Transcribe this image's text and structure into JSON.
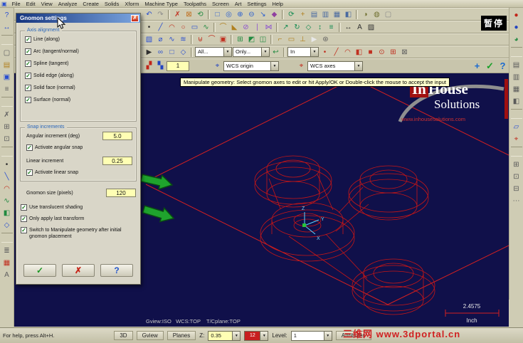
{
  "app": {
    "pause_overlay": "暂停"
  },
  "menu": {
    "app_icon_glyph": "▣",
    "items": [
      "File",
      "Edit",
      "View",
      "Analyze",
      "Create",
      "Solids",
      "Xform",
      "Machine Type",
      "Toolpaths",
      "Screen",
      "Art",
      "Settings",
      "Help"
    ]
  },
  "toolbars": {
    "row1": [
      {
        "n": "undo-icon",
        "g": "↶",
        "c": "#2a4fd0"
      },
      {
        "n": "redo-icon",
        "g": "↷",
        "c": "#8a8a8a"
      },
      {
        "n": "separator"
      },
      {
        "n": "delete-entities-icon",
        "g": "✗",
        "c": "#c03020"
      },
      {
        "n": "delete-duplicates-icon",
        "g": "⊠",
        "c": "#c07020"
      },
      {
        "n": "undelete-icon",
        "g": "⟲",
        "c": "#208a40"
      },
      {
        "n": "separator"
      },
      {
        "n": "zoom-window-icon",
        "g": "□",
        "c": "#2a5fd0"
      },
      {
        "n": "zoom-target-icon",
        "g": "◎",
        "c": "#2a5fd0"
      },
      {
        "n": "zoom-in-icon",
        "g": "⊕",
        "c": "#2a5fd0"
      },
      {
        "n": "zoom-out-icon",
        "g": "⊖",
        "c": "#2a5fd0"
      },
      {
        "n": "unzoom-icon",
        "g": "↘",
        "c": "#2a5fd0"
      },
      {
        "n": "repaint-icon",
        "g": "◆",
        "c": "#9040a0"
      },
      {
        "n": "separator"
      },
      {
        "n": "dynamic-rotate-icon",
        "g": "⟳",
        "c": "#108a50"
      },
      {
        "n": "pan-icon",
        "g": "+",
        "c": "#b08020"
      },
      {
        "n": "gview-top-icon",
        "g": "▤",
        "c": "#4a6aa0"
      },
      {
        "n": "gview-front-icon",
        "g": "▥",
        "c": "#4a6aa0"
      },
      {
        "n": "gview-right-icon",
        "g": "▦",
        "c": "#4a6aa0"
      },
      {
        "n": "gview-iso-icon",
        "g": "◧",
        "c": "#4a6aa0"
      },
      {
        "n": "separator"
      },
      {
        "n": "shading-icon",
        "g": "◑",
        "c": "#707030"
      },
      {
        "n": "wireframe-icon",
        "g": "◍",
        "c": "#707030"
      },
      {
        "n": "screen-blank-icon",
        "g": "▢",
        "c": "#8a8a8a"
      }
    ],
    "row2": [
      {
        "n": "create-point-icon",
        "g": "•",
        "c": "#303030"
      },
      {
        "n": "create-line-icon",
        "g": "╱",
        "c": "#2a4fd0"
      },
      {
        "n": "create-arc-icon",
        "g": "◠",
        "c": "#c03020"
      },
      {
        "n": "create-circle-icon",
        "g": "○",
        "c": "#c03020"
      },
      {
        "n": "create-rectangle-icon",
        "g": "▭",
        "c": "#2a4fd0"
      },
      {
        "n": "create-spline-icon",
        "g": "∿",
        "c": "#208a40"
      },
      {
        "n": "separator"
      },
      {
        "n": "fillet-icon",
        "g": "⌒",
        "c": "#b08020"
      },
      {
        "n": "chamfer-icon",
        "g": "◣",
        "c": "#b08020"
      },
      {
        "n": "trim-icon",
        "g": "⊘",
        "c": "#8a4fd0"
      },
      {
        "n": "break-icon",
        "g": "∣",
        "c": "#8a4fd0"
      },
      {
        "n": "join-icon",
        "g": "⋈",
        "c": "#8a4fd0"
      },
      {
        "n": "separator"
      },
      {
        "n": "xform-translate-icon",
        "g": "↗",
        "c": "#108a50"
      },
      {
        "n": "xform-rotate-icon",
        "g": "↻",
        "c": "#108a50"
      },
      {
        "n": "xform-mirror-icon",
        "g": "◇",
        "c": "#108a50"
      },
      {
        "n": "xform-scale-icon",
        "g": "↕",
        "c": "#108a50"
      },
      {
        "n": "xform-offset-icon",
        "g": "≡",
        "c": "#108a50"
      },
      {
        "n": "separator"
      },
      {
        "n": "dimension-icon",
        "g": "↔",
        "c": "#303030"
      },
      {
        "n": "note-text-icon",
        "g": "A",
        "c": "#303030"
      },
      {
        "n": "hatch-icon",
        "g": "▨",
        "c": "#303030"
      }
    ],
    "row3": [
      {
        "n": "solid-extrude-icon",
        "g": "▧",
        "c": "#2a4fd0"
      },
      {
        "n": "solid-revolve-icon",
        "g": "⌀",
        "c": "#2a4fd0"
      },
      {
        "n": "solid-sweep-icon",
        "g": "∿",
        "c": "#2a4fd0"
      },
      {
        "n": "solid-loft-icon",
        "g": "≋",
        "c": "#2a4fd0"
      },
      {
        "n": "separator"
      },
      {
        "n": "solid-boolean-icon",
        "g": "⊎",
        "c": "#c03020"
      },
      {
        "n": "solid-fillet-icon",
        "g": "⌒",
        "c": "#c03020"
      },
      {
        "n": "solid-shell-icon",
        "g": "▣",
        "c": "#c03020"
      },
      {
        "n": "separator"
      },
      {
        "n": "surface-net-icon",
        "g": "⊞",
        "c": "#208a40"
      },
      {
        "n": "surface-trim-icon",
        "g": "◩",
        "c": "#208a40"
      },
      {
        "n": "surface-blend-icon",
        "g": "◫",
        "c": "#208a40"
      },
      {
        "n": "separator"
      },
      {
        "n": "toolpath-contour-icon",
        "g": "⌐",
        "c": "#b08020"
      },
      {
        "n": "toolpath-pocket-icon",
        "g": "▭",
        "c": "#b08020"
      },
      {
        "n": "toolpath-drill-icon",
        "g": "⊥",
        "c": "#b08020"
      },
      {
        "n": "select-arrow-icon",
        "g": "▶",
        "c": "#e8e8e8"
      },
      {
        "n": "machine-settings-icon",
        "g": "⊛",
        "c": "#606060"
      }
    ],
    "row4_pre": [
      {
        "n": "selection-cursor-icon",
        "g": "▶",
        "c": "#303030"
      },
      {
        "n": "chain-select-icon",
        "g": "∞",
        "c": "#2a4fd0"
      },
      {
        "n": "window-select-icon",
        "g": "□",
        "c": "#2a4fd0"
      },
      {
        "n": "polygon-select-icon",
        "g": "◇",
        "c": "#2a4fd0"
      },
      {
        "n": "separator"
      }
    ],
    "row4_mid": [
      {
        "n": "select-last-icon",
        "g": "↩",
        "c": "#208a40"
      },
      {
        "n": "separator"
      }
    ],
    "row4_post": [
      {
        "n": "quick-mask-points-icon",
        "g": "•",
        "c": "#c03020"
      },
      {
        "n": "quick-mask-lines-icon",
        "g": "╱",
        "c": "#c03020"
      },
      {
        "n": "quick-mask-arcs-icon",
        "g": "◠",
        "c": "#c03020"
      },
      {
        "n": "quick-mask-surfaces-icon",
        "g": "◧",
        "c": "#c03020"
      },
      {
        "n": "quick-mask-solids-icon",
        "g": "■",
        "c": "#c03020"
      },
      {
        "n": "quick-mask-results-icon",
        "g": "⊙",
        "c": "#c03020"
      },
      {
        "n": "quick-mask-groups-icon",
        "g": "⊞",
        "c": "#c03020"
      },
      {
        "n": "quick-mask-clear-icon",
        "g": "⊠",
        "c": "#606060"
      }
    ],
    "filters": {
      "all": "All...",
      "only": "Only...",
      "in_label": "In"
    },
    "row5_pre": [
      {
        "n": "gnomon-plane-icon",
        "g": "▞",
        "c": "#c22418"
      },
      {
        "n": "gnomon-3d-icon",
        "g": "▚",
        "c": "#2244c0"
      }
    ],
    "row5_icons": {
      "origin_icon": "⌖",
      "axes_icon": "⌖"
    },
    "ribbon": {
      "entry_value": "1",
      "wcs_origin": "WCS origin",
      "wcs_axes": "WCS axes",
      "add_glyph": "+",
      "ok_glyph": "✓",
      "help_glyph": "?"
    }
  },
  "left_toolbar": [
    {
      "n": "analyze-entity-icon",
      "g": "?",
      "c": "#2a4fd0"
    },
    {
      "n": "analyze-distance-icon",
      "g": "↔",
      "c": "#2a4fd0"
    },
    {
      "n": "hseparator"
    },
    {
      "n": "file-new-icon",
      "g": "▢",
      "c": "#606060"
    },
    {
      "n": "file-open-icon",
      "g": "▤",
      "c": "#b08020"
    },
    {
      "n": "file-save-icon",
      "g": "▣",
      "c": "#2a4fd0"
    },
    {
      "n": "print-icon",
      "g": "≡",
      "c": "#606060"
    },
    {
      "n": "hseparator"
    },
    {
      "n": "cut-icon",
      "g": "✗",
      "c": "#606060"
    },
    {
      "n": "copy-icon",
      "g": "⊞",
      "c": "#606060"
    },
    {
      "n": "paste-icon",
      "g": "⊡",
      "c": "#606060"
    },
    {
      "n": "hseparator"
    },
    {
      "n": "point-icon",
      "g": "•",
      "c": "#303030"
    },
    {
      "n": "line-icon",
      "g": "╲",
      "c": "#2a4fd0"
    },
    {
      "n": "arc-icon",
      "g": "◠",
      "c": "#c03020"
    },
    {
      "n": "spline-icon",
      "g": "∿",
      "c": "#208a40"
    },
    {
      "n": "surface-icon",
      "g": "◧",
      "c": "#208a40"
    },
    {
      "n": "solids-icon",
      "g": "◇",
      "c": "#2a4fd0"
    },
    {
      "n": "hseparator"
    },
    {
      "n": "levels-icon",
      "g": "≣",
      "c": "#606060"
    },
    {
      "n": "color-palette-icon",
      "g": "▦",
      "c": "#c03020"
    },
    {
      "n": "entity-attributes-icon",
      "g": "A",
      "c": "#606060"
    }
  ],
  "right_toolbar": [
    {
      "n": "dynamic-gview-icon",
      "g": "●",
      "c": "#c22418"
    },
    {
      "n": "rotate-view-icon",
      "g": "●",
      "c": "#2244c0"
    },
    {
      "n": "spin-view-icon",
      "g": "◕",
      "c": "#208a40"
    },
    {
      "n": "hseparator"
    },
    {
      "n": "view-top-icon",
      "g": "▤",
      "c": "#5a5a5a"
    },
    {
      "n": "view-front-icon",
      "g": "▥",
      "c": "#5a5a5a"
    },
    {
      "n": "view-side-icon",
      "g": "▦",
      "c": "#5a5a5a"
    },
    {
      "n": "view-iso-icon",
      "g": "◧",
      "c": "#5a5a5a"
    },
    {
      "n": "hseparator"
    },
    {
      "n": "cplane-icon",
      "g": "▱",
      "c": "#2a4fd0"
    },
    {
      "n": "wcs-icon",
      "g": "⌖",
      "c": "#c03020"
    },
    {
      "n": "hseparator"
    },
    {
      "n": "viewsheets-icon",
      "g": "⊞",
      "c": "#5a5a5a"
    },
    {
      "n": "fit-icon",
      "g": "⊡",
      "c": "#5a5a5a"
    },
    {
      "n": "zoom-previous-icon",
      "g": "⊟",
      "c": "#5a5a5a"
    },
    {
      "n": "grid-settings-icon",
      "g": "⋯",
      "c": "#5a5a5a"
    }
  ],
  "dialog": {
    "title": "Gnomon settings",
    "close_glyph": "✗",
    "groups": {
      "axis_alignment": {
        "label": "Axis alignment",
        "items": [
          {
            "n": "checkbox-line-along",
            "label": "Line (along)"
          },
          {
            "n": "checkbox-arc-tangent-normal",
            "label": "Arc (tangent/normal)"
          },
          {
            "n": "checkbox-spline-tangent",
            "label": "Spline (tangent)"
          },
          {
            "n": "checkbox-solid-edge-along",
            "label": "Solid edge (along)"
          },
          {
            "n": "checkbox-solid-face-normal",
            "label": "Solid face (normal)"
          },
          {
            "n": "checkbox-surface-normal",
            "label": "Surface (normal)"
          }
        ]
      },
      "snap": {
        "label": "Snap increments",
        "angular_label": "Angular increment (deg)",
        "angular_value": "5.0",
        "angular_snap_label": "Activate angular snap",
        "linear_label": "Linear increment",
        "linear_value": "0.25",
        "linear_snap_label": "Activate linear snap"
      }
    },
    "gnomon_size_label": "Gnomon size (pixels)",
    "gnomon_size_value": "120",
    "options": [
      {
        "n": "checkbox-use-translucent-shading",
        "label": "Use translucent shading"
      },
      {
        "n": "checkbox-only-apply-last-transform",
        "label": "Only apply last transform"
      },
      {
        "n": "checkbox-switch-to-manipulate",
        "label": "Switch to Manipulate geometry after initial gnomon placement"
      }
    ],
    "buttons": {
      "ok_glyph": "✓",
      "cancel_glyph": "✗",
      "help_glyph": "?"
    }
  },
  "tooltip": "Manipulate geometry: Select gnomon axes to edit or hit Apply/OK or Double-click the mouse to accept the input",
  "viewport": {
    "status_line": "Gview:ISO   WCS:TOP    T/Cplane:TOP",
    "scale_value": "2.4575",
    "scale_unit": "Inch",
    "gnomon": {
      "x": "X",
      "y": "Y",
      "z": "Z"
    },
    "logo": {
      "brand_in": "In",
      "brand_house": "House",
      "brand_solutions": "Solutions",
      "url": "www.inhousesolutions.com"
    }
  },
  "statusbar": {
    "help_text": "For help, press Alt+H.",
    "mode_3d": "3D",
    "gview": "Gview",
    "planes": "Planes",
    "z_label": "Z:",
    "z_value": "0.35",
    "color_value": "12",
    "level_label": "Level:",
    "level_value": "1",
    "attributes": "Attributes"
  },
  "watermark": "三维网 www.3dportal.cn"
}
